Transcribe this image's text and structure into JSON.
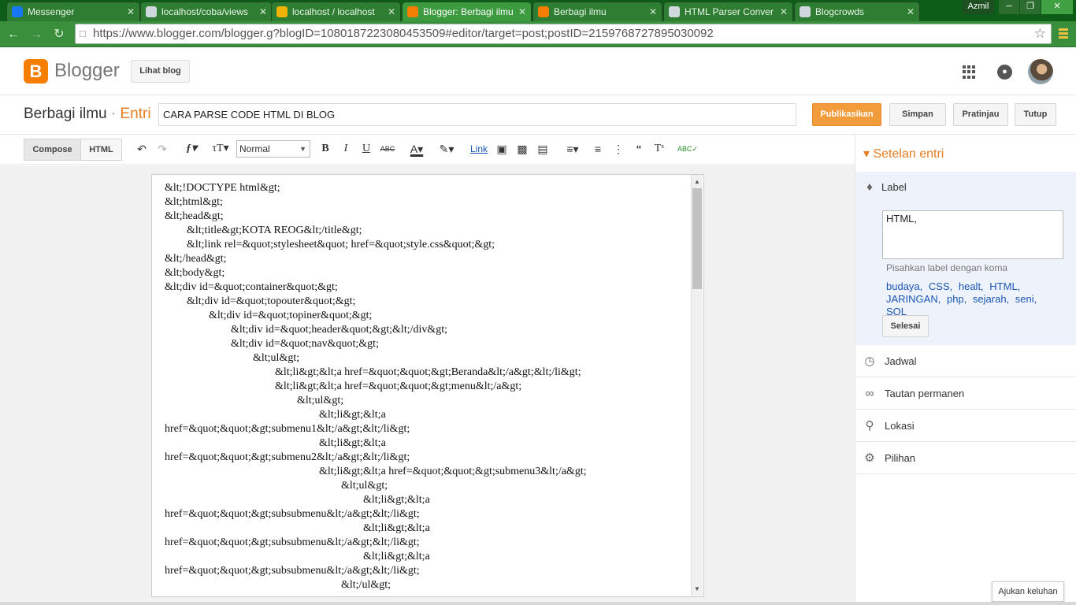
{
  "browser": {
    "tabs": [
      {
        "label": "Messenger",
        "icon": "messenger-icon",
        "color": "#1877f2"
      },
      {
        "label": "localhost/coba/views",
        "icon": "page-icon",
        "color": "#cfd8dc"
      },
      {
        "label": "localhost / localhost",
        "icon": "phpmyadmin-icon",
        "color": "#f0b400"
      },
      {
        "label": "Blogger: Berbagi ilmu",
        "icon": "blogger-icon",
        "color": "#f57d00"
      },
      {
        "label": "Berbagi ilmu",
        "icon": "blogger-icon",
        "color": "#f57d00"
      },
      {
        "label": "HTML Parser Conver",
        "icon": "page-icon",
        "color": "#cfd8dc"
      },
      {
        "label": "Blogcrowds",
        "icon": "page-icon",
        "color": "#cfd8dc"
      }
    ],
    "user": "Azmil",
    "url": "https://www.blogger.com/blogger.g?blogID=1080187223080453509#editor/target=post;postID=2159768727895030092"
  },
  "header": {
    "logo_letter": "B",
    "logo_text": "Blogger",
    "view_blog": "Lihat blog"
  },
  "post": {
    "blog_name": "Berbagi ilmu",
    "separator": "·",
    "section": "Entri",
    "title": "CARA PARSE CODE HTML DI BLOG",
    "publish": "Publikasikan",
    "save": "Simpan",
    "preview": "Pratinjau",
    "close": "Tutup"
  },
  "toolbar": {
    "compose": "Compose",
    "html": "HTML",
    "format": "Normal",
    "link": "Link"
  },
  "editor": {
    "lines": [
      "&lt;!DOCTYPE html&gt;",
      "&lt;html&gt;",
      "&lt;head&gt;",
      "        &lt;title&gt;KOTA REOG&lt;/title&gt;",
      "        &lt;link rel=&quot;stylesheet&quot; href=&quot;style.css&quot;&gt;",
      "&lt;/head&gt;",
      "&lt;body&gt;",
      "&lt;div id=&quot;container&quot;&gt;",
      "        &lt;div id=&quot;topouter&quot;&gt;",
      "                &lt;div id=&quot;topiner&quot;&gt;",
      "                        &lt;div id=&quot;header&quot;&gt;&lt;/div&gt;",
      "                        &lt;div id=&quot;nav&quot;&gt;",
      "                                &lt;ul&gt;",
      "                                        &lt;li&gt;&lt;a href=&quot;&quot;&gt;Beranda&lt;/a&gt;&lt;/li&gt;",
      "                                        &lt;li&gt;&lt;a href=&quot;&quot;&gt;menu&lt;/a&gt;",
      "                                                &lt;ul&gt;",
      "                                                        &lt;li&gt;&lt;a",
      "href=&quot;&quot;&gt;submenu1&lt;/a&gt;&lt;/li&gt;",
      "                                                        &lt;li&gt;&lt;a",
      "href=&quot;&quot;&gt;submenu2&lt;/a&gt;&lt;/li&gt;",
      "                                                        &lt;li&gt;&lt;a href=&quot;&quot;&gt;submenu3&lt;/a&gt;",
      "                                                                &lt;ul&gt;",
      "                                                                        &lt;li&gt;&lt;a",
      "href=&quot;&quot;&gt;subsubmenu&lt;/a&gt;&lt;/li&gt;",
      "                                                                        &lt;li&gt;&lt;a",
      "href=&quot;&quot;&gt;subsubmenu&lt;/a&gt;&lt;/li&gt;",
      "                                                                        &lt;li&gt;&lt;a",
      "href=&quot;&quot;&gt;subsubmenu&lt;/a&gt;&lt;/li&gt;",
      "                                                                &lt;/ul&gt;"
    ]
  },
  "sidebar": {
    "heading": "Setelan entri",
    "label_section": "Label",
    "label_value": "HTML,",
    "hint": "Pisahkan label dengan koma",
    "labels": [
      "budaya,",
      "CSS,",
      "healt,",
      "HTML,",
      "JARINGAN,",
      "php,",
      "sejarah,",
      "seni,",
      "SQL"
    ],
    "done": "Selesai",
    "items": [
      "Jadwal",
      "Tautan permanen",
      "Lokasi",
      "Pilihan"
    ]
  },
  "feedback": "Ajukan keluhan"
}
